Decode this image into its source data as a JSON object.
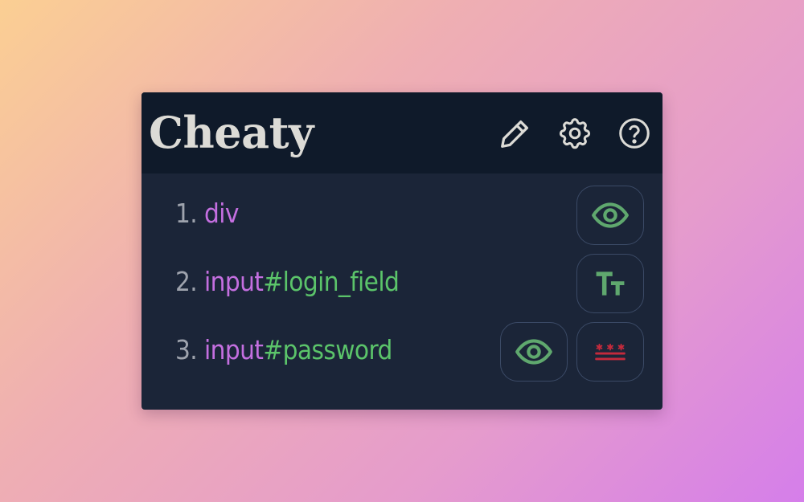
{
  "app": {
    "title": "Cheaty"
  },
  "header_icons": [
    "pencil-icon",
    "gear-icon",
    "help-icon"
  ],
  "colors": {
    "header_bg": "#0f1a2a",
    "panel_bg": "#1b2538",
    "title": "#dcdbd6",
    "tag": "#c46fe0",
    "id": "#5bc46a",
    "number": "#9ea3ad",
    "eye_icon": "#5fa86e",
    "mask_icon": "#c42a3c",
    "button_border": "#3b4a66"
  },
  "items": [
    {
      "number": "1.",
      "tag": "div",
      "id": "",
      "actions": [
        "eye-icon"
      ]
    },
    {
      "number": "2.",
      "tag": "input",
      "id": "#login_field",
      "actions": [
        "text-size-icon"
      ]
    },
    {
      "number": "3.",
      "tag": "input",
      "id": "#password",
      "actions": [
        "eye-icon",
        "password-mask-icon"
      ]
    }
  ]
}
